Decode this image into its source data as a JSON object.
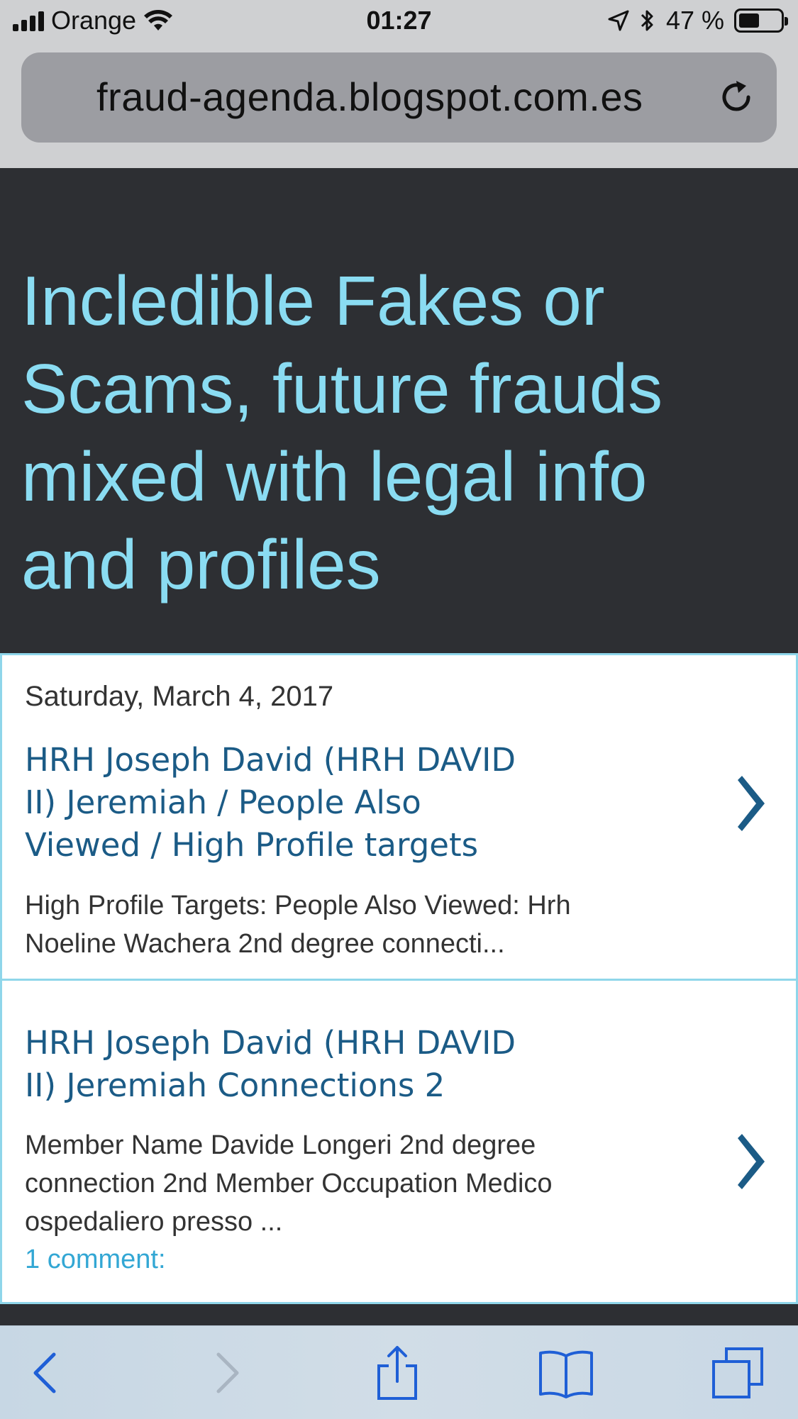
{
  "status_bar": {
    "carrier": "Orange",
    "time": "01:27",
    "battery": "47 %",
    "battery_level": 0.47
  },
  "browser": {
    "url": "fraud-agenda.blogspot.com.es"
  },
  "blog": {
    "title": "Incledible Fakes or Scams, future frauds mixed with legal info and profiles"
  },
  "posts": [
    {
      "date": "Saturday, March 4, 2017",
      "title_lines": [
        "HRH Joseph David (HRH DAVID",
        "II) Jeremiah / People Also",
        "Viewed / High Profile targets"
      ],
      "snippet_lines": [
        "High Profile Targets: People Also Viewed: Hrh",
        "Noeline Wachera 2nd degree connecti..."
      ]
    },
    {
      "title_lines": [
        "HRH Joseph David (HRH DAVID",
        "II) Jeremiah Connections 2"
      ],
      "snippet_lines": [
        "Member Name Davide Longeri 2nd degree",
        "connection 2nd Member Occupation Medico",
        "ospedaliero presso ..."
      ],
      "comments": "1 comment:"
    }
  ],
  "colors": {
    "header_bg": "#2d2f33",
    "title_color": "#8adcf2",
    "post_title_color": "#1b5b86",
    "chevron_color": "#1b5b86",
    "comment_color": "#33a7d4",
    "toolbar_icon": "#1f5fd6"
  },
  "toolbar": {
    "icons": [
      "back-icon",
      "forward-icon",
      "share-icon",
      "bookmarks-icon",
      "tabs-icon"
    ]
  }
}
